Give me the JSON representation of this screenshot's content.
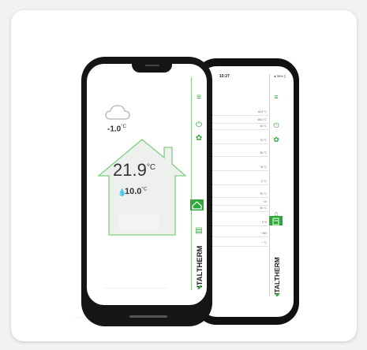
{
  "back_screen": {
    "status_time": "10:27",
    "status_battery": "● 39% ▯",
    "rows": [
      {
        "label": "",
        "value": "18.5 °C"
      },
      {
        "label": "",
        "value": "68.0 °C"
      },
      {
        "label": "",
        "value": "64 °C"
      },
      {
        "label": "",
        "value": "70 °C"
      },
      {
        "label": "",
        "value": "80 °C"
      },
      {
        "label": "",
        "value": "78 °C"
      },
      {
        "label": "",
        "value": "-0 °C"
      },
      {
        "label": "",
        "value": "91 °C"
      },
      {
        "label": "",
        "value": "~10"
      },
      {
        "label": "",
        "value": "81 °C"
      },
      {
        "label": "",
        "value": "0 %"
      },
      {
        "label": "",
        "value": "~ 960"
      },
      {
        "label": "",
        "value": "~ °C"
      }
    ],
    "brand": "ITALTHERM"
  },
  "front_screen": {
    "outdoor_value": "-1.0",
    "outdoor_unit": "°C",
    "room_value": "21.9",
    "room_unit": "°C",
    "setpoint_value": "10.0",
    "setpoint_unit": "°C",
    "brand": "ITALTHERM"
  },
  "colors": {
    "accent": "#2ea836",
    "house_stroke": "#7fcf7f",
    "house_fill": "#eef0ee"
  },
  "icons": {
    "menu": "menu-icon",
    "power": "power-icon",
    "settings": "gear-icon",
    "home": "home-icon",
    "list": "list-icon"
  }
}
